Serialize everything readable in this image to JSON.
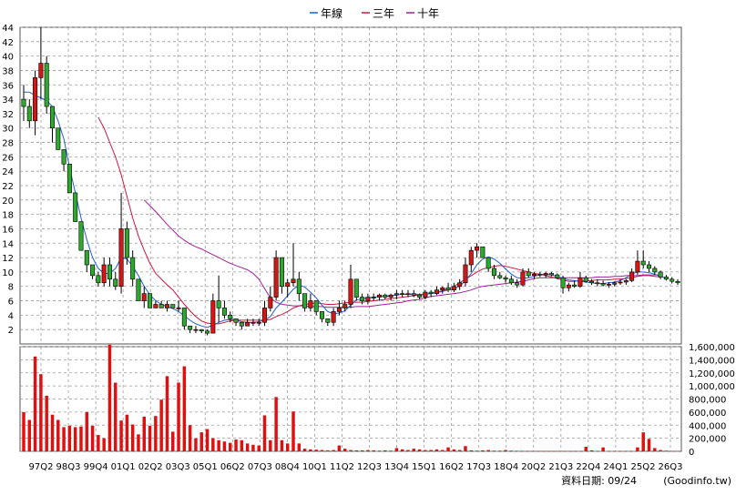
{
  "chart_data": {
    "type": "candlestick",
    "legend": [
      {
        "name": "年線",
        "color": "#1f5fd6"
      },
      {
        "name": "三年",
        "color": "#d2143c"
      },
      {
        "name": "十年",
        "color": "#a01ea0"
      }
    ],
    "colors": {
      "up": "#d81414",
      "down": "#2ea82e",
      "volume": "#e01010",
      "grid": "#9a9a9a"
    },
    "price_axis": {
      "min": 0,
      "max": 44,
      "ticks": [
        2,
        4,
        6,
        8,
        10,
        12,
        14,
        16,
        18,
        20,
        22,
        24,
        26,
        28,
        30,
        32,
        34,
        36,
        38,
        40,
        42,
        44
      ]
    },
    "volume_axis": {
      "min": 0,
      "max": 1600000,
      "ticks": [
        "0",
        "200,000",
        "400,000",
        "600,000",
        "800,000",
        "1,000,000",
        "1,200,000",
        "1,400,000",
        "1,600,000"
      ]
    },
    "x_ticks": [
      "97Q2",
      "98Q3",
      "99Q4",
      "01Q1",
      "02Q2",
      "03Q3",
      "05Q1",
      "06Q2",
      "07Q3",
      "08Q4",
      "10Q1",
      "11Q2",
      "12Q3",
      "13Q4",
      "15Q1",
      "16Q2",
      "17Q3",
      "18Q4",
      "20Q2",
      "21Q3",
      "22Q4",
      "24Q1",
      "25Q2",
      "26Q3"
    ],
    "candles": [
      [
        34,
        36,
        31,
        33
      ],
      [
        33,
        34,
        30,
        31
      ],
      [
        31,
        38,
        29,
        37
      ],
      [
        37,
        44,
        34,
        39
      ],
      [
        39,
        40,
        32,
        33
      ],
      [
        33,
        31,
        28,
        30
      ],
      [
        30,
        29,
        27,
        27
      ],
      [
        27,
        26,
        24,
        25
      ],
      [
        25,
        24,
        21,
        21
      ],
      [
        21,
        20,
        18,
        17
      ],
      [
        17,
        16,
        14,
        13
      ],
      [
        13,
        12,
        10,
        11
      ],
      [
        11,
        10,
        9,
        9.5
      ],
      [
        9.5,
        10,
        8,
        8.5
      ],
      [
        8.5,
        12,
        8,
        11
      ],
      [
        11,
        12,
        8,
        9
      ],
      [
        9,
        10,
        7.5,
        8
      ],
      [
        8,
        21,
        7,
        16
      ],
      [
        16,
        17,
        11,
        12
      ],
      [
        12,
        13,
        8,
        9
      ],
      [
        9,
        8,
        6,
        6
      ],
      [
        6,
        8,
        5,
        7
      ],
      [
        7,
        7,
        5,
        5
      ],
      [
        5,
        6,
        5,
        5.5
      ],
      [
        5.5,
        6,
        5,
        5
      ],
      [
        5,
        6,
        4.5,
        5.5
      ],
      [
        5.5,
        5.5,
        5,
        5
      ],
      [
        5,
        6,
        4.5,
        5
      ],
      [
        5,
        3,
        2,
        2.5
      ],
      [
        2.5,
        2.5,
        1.5,
        2
      ],
      [
        2,
        2.5,
        1.5,
        2
      ],
      [
        2,
        2,
        1.5,
        1.8
      ],
      [
        1.8,
        2,
        1.2,
        1.5
      ],
      [
        1.5,
        7,
        1.5,
        6
      ],
      [
        6,
        9.5,
        3,
        5
      ],
      [
        5,
        6,
        3.5,
        4
      ],
      [
        4,
        4.5,
        3,
        3.5
      ],
      [
        3.5,
        3.5,
        2.5,
        3
      ],
      [
        3,
        3,
        2,
        2.5
      ],
      [
        2.5,
        3.5,
        2.5,
        3
      ],
      [
        3,
        3.5,
        2.5,
        3
      ],
      [
        3,
        3.5,
        2.5,
        3
      ],
      [
        3,
        6,
        2.5,
        5
      ],
      [
        5,
        8,
        4.5,
        6.5
      ],
      [
        6.5,
        13,
        6,
        12
      ],
      [
        12,
        11,
        7,
        8
      ],
      [
        8,
        9,
        6.5,
        8.5
      ],
      [
        8.5,
        14,
        8,
        9
      ],
      [
        9,
        10,
        6,
        7
      ],
      [
        7,
        6,
        4.5,
        5
      ],
      [
        5,
        7,
        4.5,
        6
      ],
      [
        6,
        5,
        4,
        4.5
      ],
      [
        4.5,
        4,
        3,
        3.5
      ],
      [
        3.5,
        3,
        2.5,
        3
      ],
      [
        3,
        5,
        2.5,
        4.5
      ],
      [
        4.5,
        6,
        4,
        5
      ],
      [
        5,
        6,
        4.5,
        5.5
      ],
      [
        5.5,
        11,
        5,
        9
      ],
      [
        9,
        8,
        6,
        6.5
      ],
      [
        6.5,
        7,
        5.5,
        6
      ],
      [
        6,
        7,
        5.5,
        6.5
      ],
      [
        6.5,
        7,
        6,
        6.5
      ],
      [
        6.5,
        7,
        6,
        6.8
      ],
      [
        6.8,
        7,
        6.2,
        6.5
      ],
      [
        6.5,
        7,
        6,
        6.8
      ],
      [
        6.8,
        7.5,
        6.2,
        7
      ],
      [
        7,
        7.5,
        6.5,
        7
      ],
      [
        7,
        7.5,
        6.5,
        7
      ],
      [
        7,
        7.5,
        6.5,
        6.8
      ],
      [
        6.8,
        7,
        6.2,
        6.5
      ],
      [
        6.5,
        7.5,
        6.2,
        7.2
      ],
      [
        7.2,
        7.5,
        6.5,
        7
      ],
      [
        7,
        8,
        6.8,
        7.5
      ],
      [
        7.5,
        8,
        7,
        7.8
      ],
      [
        7.8,
        8.5,
        7.2,
        7.5
      ],
      [
        7.5,
        8.5,
        7.2,
        8
      ],
      [
        8,
        9,
        7.5,
        8.5
      ],
      [
        8.5,
        12,
        8,
        11
      ],
      [
        11,
        13.5,
        10,
        13
      ],
      [
        13,
        14,
        12,
        13.5
      ],
      [
        13.5,
        13,
        12,
        12
      ],
      [
        12,
        12,
        10,
        10.5
      ],
      [
        10.5,
        11,
        9,
        9.5
      ],
      [
        9.5,
        10,
        9,
        9.2
      ],
      [
        9.2,
        9.5,
        8.5,
        9
      ],
      [
        9,
        9.5,
        8.2,
        8.5
      ],
      [
        8.5,
        9,
        7.8,
        8.2
      ],
      [
        8.2,
        10.5,
        8,
        10
      ],
      [
        10,
        10.5,
        9.2,
        9.5
      ],
      [
        9.5,
        10,
        9,
        9.7
      ],
      [
        9.7,
        10,
        9.3,
        9.6
      ],
      [
        9.6,
        10,
        9.2,
        9.8
      ],
      [
        9.8,
        10,
        9.4,
        9.6
      ],
      [
        9.6,
        9.8,
        9,
        9.2
      ],
      [
        9.2,
        9.5,
        7,
        7.8
      ],
      [
        7.8,
        8.5,
        7.3,
        8.2
      ],
      [
        8.2,
        8.8,
        7.8,
        8
      ],
      [
        8,
        10,
        7.8,
        9.2
      ],
      [
        9.2,
        9.5,
        8.5,
        8.7
      ],
      [
        8.7,
        9,
        8.2,
        8.5
      ],
      [
        8.5,
        9,
        8,
        8.4
      ],
      [
        8.4,
        8.8,
        8,
        8.2
      ],
      [
        8.2,
        8.6,
        7.8,
        8.3
      ],
      [
        8.3,
        8.7,
        8,
        8.5
      ],
      [
        8.5,
        9,
        8.2,
        8.6
      ],
      [
        8.6,
        9,
        8.2,
        8.8
      ],
      [
        8.8,
        10.5,
        8.6,
        10
      ],
      [
        10,
        13,
        9.6,
        11.5
      ],
      [
        11.5,
        13,
        10.5,
        11
      ],
      [
        11,
        11.5,
        10,
        10.5
      ],
      [
        10.5,
        10.8,
        9.6,
        10
      ],
      [
        10,
        10.2,
        9,
        9.3
      ],
      [
        9.3,
        9.6,
        8.8,
        9
      ],
      [
        9,
        9.3,
        8.4,
        8.7
      ],
      [
        8.7,
        9,
        8.2,
        8.5
      ]
    ],
    "ma_year": [
      35,
      35,
      34.5,
      34.2,
      33.8,
      33,
      31,
      28.5,
      24.5,
      21,
      17.5,
      14.5,
      12,
      10.5,
      9.8,
      9.8,
      10.5,
      12,
      11.8,
      10.8,
      9.5,
      8,
      6.8,
      6,
      5.5,
      5.2,
      4.9,
      4.5,
      3.9,
      3.3,
      2.8,
      2.5,
      2.3,
      2.6,
      3,
      3.3,
      3.4,
      3.3,
      3.1,
      3,
      3,
      3.1,
      3.3,
      3.8,
      5,
      5.8,
      6.7,
      7.6,
      8.2,
      7.9,
      7.2,
      6.4,
      5.4,
      4.5,
      4.2,
      4.3,
      4.6,
      5.4,
      6.1,
      6.3,
      6.4,
      6.5,
      6.6,
      6.6,
      6.7,
      6.8,
      6.9,
      6.9,
      6.9,
      6.9,
      6.9,
      7,
      7.1,
      7.3,
      7.5,
      7.7,
      8,
      8.8,
      9.8,
      11,
      11.8,
      12.1,
      11.8,
      11.2,
      10.4,
      9.7,
      9.2,
      9.1,
      9.2,
      9.4,
      9.6,
      9.7,
      9.6,
      9.4,
      9.1,
      8.9,
      8.8,
      8.7,
      8.6,
      8.5,
      8.4,
      8.4,
      8.5,
      8.6,
      8.8,
      9.2,
      9.7,
      10,
      10,
      9.9,
      9.7,
      9.4,
      9.1
    ],
    "ma_3y": [
      null,
      null,
      null,
      null,
      null,
      null,
      null,
      null,
      null,
      null,
      null,
      null,
      null,
      31.5,
      30,
      28,
      26,
      23.5,
      20.5,
      17.5,
      15,
      13,
      11.2,
      9.8,
      9,
      8.2,
      7.5,
      6.5,
      5.5,
      4.6,
      3.8,
      3.2,
      2.9,
      2.8,
      2.8,
      3,
      3.2,
      3.3,
      3.3,
      3.3,
      3.3,
      3.3,
      3.3,
      3.4,
      3.8,
      4.1,
      4.5,
      5,
      5.3,
      5.5,
      5.6,
      5.7,
      5.6,
      5.5,
      5.5,
      5.6,
      5.7,
      5.8,
      5.8,
      5.8,
      5.9,
      6,
      6.1,
      6.2,
      6.3,
      6.4,
      6.5,
      6.6,
      6.7,
      6.8,
      6.9,
      7,
      7.2,
      7.4,
      7.7,
      8,
      8.5,
      9,
      9.5,
      10,
      10.4,
      10.6,
      10.8,
      10.9,
      10.8,
      10.6,
      10.4,
      10.2,
      10,
      9.8,
      9.7,
      9.5,
      9.3,
      9.1,
      8.9,
      8.7,
      8.7,
      8.8,
      8.8,
      8.8,
      8.9,
      8.9,
      8.9,
      9,
      9,
      9.1,
      9.2,
      9.4,
      9.5,
      9.5,
      9.4,
      9.3
    ],
    "ma_10y": [
      null,
      null,
      null,
      null,
      null,
      null,
      null,
      null,
      null,
      null,
      null,
      null,
      null,
      null,
      null,
      null,
      null,
      null,
      null,
      null,
      null,
      20,
      19.2,
      18.4,
      17.5,
      16.6,
      15.8,
      15,
      14.4,
      13.9,
      13.5,
      13.2,
      12.8,
      12.4,
      12,
      11.6,
      11.2,
      10.9,
      10.6,
      10.3,
      9.8,
      9,
      7.7,
      6.4,
      5.8,
      5.5,
      5.4,
      5.3,
      5.3,
      5.3,
      5.2,
      5.2,
      5.2,
      5.1,
      5.1,
      5.1,
      5.1,
      5.1,
      5.2,
      5.2,
      5.2,
      5.3,
      5.4,
      5.5,
      5.6,
      5.7,
      5.8,
      6,
      6.1,
      6.2,
      6.4,
      6.6,
      6.7,
      6.8,
      6.9,
      7,
      7.1,
      7.3,
      7.5,
      7.8,
      8,
      8.1,
      8.2,
      8.3,
      8.4,
      8.5,
      8.6,
      8.7,
      8.9,
      9.1,
      9.2,
      9.2,
      9.2,
      9.2,
      9.2,
      9.2,
      9.2,
      9.2,
      9.2,
      9.2,
      9.3,
      9.3,
      9.3,
      9.4,
      9.4,
      9.5,
      9.5,
      9.5,
      9.6,
      9.6,
      9.6,
      9.6
    ],
    "volume": [
      600000,
      480000,
      1450000,
      1180000,
      850000,
      560000,
      480000,
      370000,
      390000,
      370000,
      380000,
      600000,
      390000,
      250000,
      200000,
      1630000,
      1050000,
      470000,
      560000,
      410000,
      260000,
      530000,
      390000,
      540000,
      790000,
      1150000,
      300000,
      1050000,
      1300000,
      400000,
      200000,
      290000,
      340000,
      200000,
      170000,
      150000,
      130000,
      180000,
      170000,
      120000,
      100000,
      90000,
      550000,
      170000,
      830000,
      170000,
      120000,
      610000,
      120000,
      40000,
      30000,
      25000,
      20000,
      15000,
      20000,
      90000,
      40000,
      20000,
      15000,
      15000,
      20000,
      15000,
      10000,
      15000,
      10000,
      50000,
      30000,
      20000,
      40000,
      30000,
      20000,
      20000,
      30000,
      20000,
      60000,
      30000,
      20000,
      80000,
      15000,
      10000,
      15000,
      20000,
      10000,
      10000,
      20000,
      10000,
      8000,
      5000,
      5000,
      5000,
      5000,
      5000,
      5000,
      5000,
      5000,
      5000,
      5000,
      5000,
      70000,
      15000,
      5000,
      60000,
      5000,
      5000,
      5000,
      5000,
      5000,
      60000,
      290000,
      190000,
      50000,
      20000,
      10000,
      5000,
      5000
    ],
    "footer": "資料日期: 09/24",
    "source": "(Goodinfo.tw)"
  }
}
